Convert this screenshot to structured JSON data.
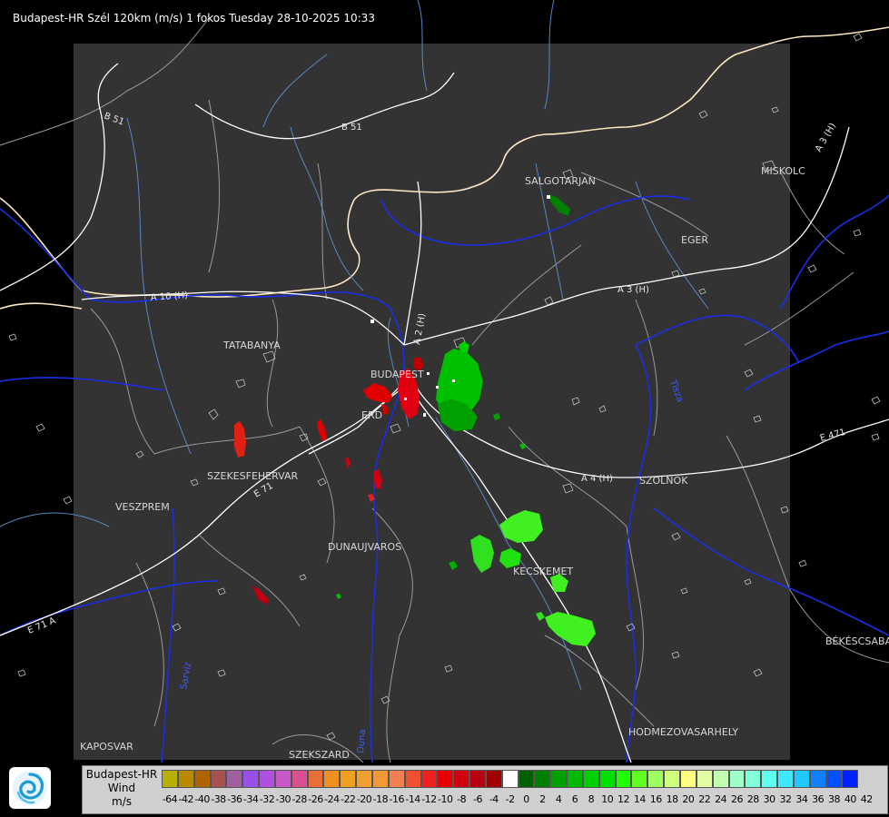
{
  "header": {
    "title": "Budapest-HR Szél 120km (m/s) 1 fokos Tuesday 28-10-2025 10:33"
  },
  "map": {
    "cities": [
      {
        "id": "salgotarjan",
        "name": "SALGOTARJAN"
      },
      {
        "id": "miskolc",
        "name": "MISKOLC"
      },
      {
        "id": "eger",
        "name": "EGER"
      },
      {
        "id": "tatabanya",
        "name": "TATABANYA"
      },
      {
        "id": "budapest",
        "name": "BUDAPEST"
      },
      {
        "id": "erd",
        "name": "ERD"
      },
      {
        "id": "szekesfehervar",
        "name": "SZEKESFEHERVAR"
      },
      {
        "id": "veszprem",
        "name": "VESZPREM"
      },
      {
        "id": "dunaujvaros",
        "name": "DUNAUJVAROS"
      },
      {
        "id": "kecskemet",
        "name": "KECSKEMET"
      },
      {
        "id": "szolnok",
        "name": "SZOLNOK"
      },
      {
        "id": "bekescsaba",
        "name": "BÉKÉSCSABA"
      },
      {
        "id": "hodmezovasarhely",
        "name": "HODMEZOVASARHELY"
      },
      {
        "id": "kaposvar",
        "name": "KAPOSVAR"
      },
      {
        "id": "szekszard",
        "name": "SZEKSZARD"
      }
    ],
    "roads": [
      {
        "id": "b51-left",
        "name": "B 51"
      },
      {
        "id": "b51-right",
        "name": "B 51"
      },
      {
        "id": "a10",
        "name": "A 10 (H)"
      },
      {
        "id": "a3",
        "name": "A 3 (H)"
      },
      {
        "id": "a3-ne",
        "name": "A 3 (H)"
      },
      {
        "id": "a2",
        "name": "A 2 (H)"
      },
      {
        "id": "a4",
        "name": "A 4 (H)"
      },
      {
        "id": "e71",
        "name": "E 71"
      },
      {
        "id": "e71-sw",
        "name": "E 71 A"
      },
      {
        "id": "e471",
        "name": "E 471"
      }
    ],
    "rivers": [
      {
        "id": "duna",
        "name": "Duna"
      },
      {
        "id": "tisza",
        "name": "Tisza"
      },
      {
        "id": "sarviz",
        "name": "Sarviz"
      }
    ],
    "colors": {
      "background": "#000000",
      "radar_area": "#333333",
      "border": "#ffe9c4",
      "river": "#1a2ee6",
      "stream": "#5a86c8",
      "road": "#ffffff",
      "county": "#c8c8c8"
    }
  },
  "legend": {
    "title": "Budapest-HR",
    "variable": "Wind",
    "unit": "m/s",
    "ticks": [
      "-64",
      "-42",
      "-40",
      "-38",
      "-36",
      "-34",
      "-32",
      "-30",
      "-28",
      "-26",
      "-24",
      "-22",
      "-20",
      "-18",
      "-16",
      "-14",
      "-12",
      "-10",
      "-8",
      "-6",
      "-4",
      "-2",
      "0",
      "2",
      "4",
      "6",
      "8",
      "10",
      "12",
      "14",
      "16",
      "18",
      "20",
      "22",
      "24",
      "26",
      "28",
      "30",
      "32",
      "34",
      "36",
      "38",
      "40",
      "42"
    ],
    "colors": [
      "#b8b000",
      "#b88a00",
      "#b06400",
      "#a85050",
      "#a060a0",
      "#9850e8",
      "#b050e0",
      "#c858c8",
      "#d85090",
      "#e87038",
      "#f09020",
      "#f0a020",
      "#f0a030",
      "#f09838",
      "#f08050",
      "#f05030",
      "#f02020",
      "#e80000",
      "#d00010",
      "#b80010",
      "#a00000",
      "#ffffff",
      "#006000",
      "#008000",
      "#00a000",
      "#00b800",
      "#00d000",
      "#00e000",
      "#20ff00",
      "#60ff20",
      "#a0ff60",
      "#d0ff80",
      "#ffff80",
      "#e0ffa0",
      "#c0ffb0",
      "#a0ffc8",
      "#80ffd8",
      "#60fff0",
      "#40e8ff",
      "#20c8ff",
      "#1080ff",
      "#0050ff",
      "#0020ff"
    ]
  }
}
